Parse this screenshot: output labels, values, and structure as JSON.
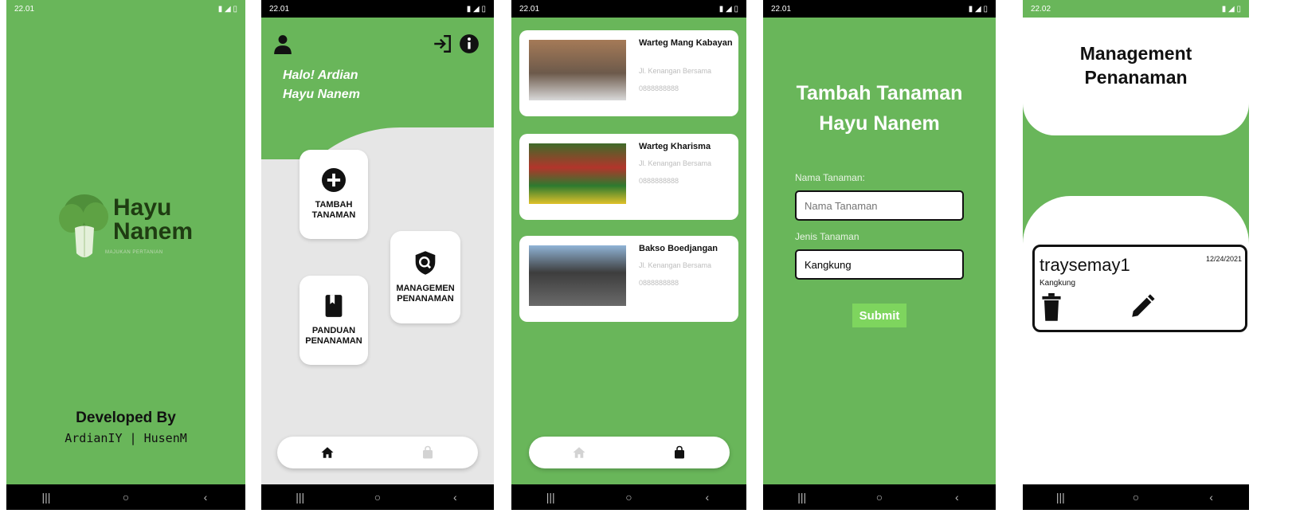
{
  "colors": {
    "brand_green": "#69b65a",
    "light_gray": "#e6e6e6",
    "submit_green": "#7ed55e",
    "black": "#111111"
  },
  "screen1": {
    "status_time": "22.01",
    "logo_title_line1": "Hayu",
    "logo_title_line2": "Nanem",
    "logo_tagline": "MAJUKAN PERTANIAN",
    "dev_title": "Developed By",
    "dev_names": "ArdianIY | HusenM"
  },
  "screen2": {
    "status_time": "22.01",
    "greeting_line1": "Halo! Ardian",
    "greeting_line2": "Hayu Nanem",
    "menu": {
      "tambah": "TAMBAH\nTANAMAN",
      "managemen": "MANAGEMEN\nPENANAMAN",
      "panduan": "PANDUAN\nPENANAMAN"
    },
    "icons": {
      "user": "user-icon",
      "logout": "logout-icon",
      "info": "info-icon",
      "home": "home-icon",
      "bag": "shopping-bag-icon"
    }
  },
  "screen3": {
    "status_time": "22.01",
    "warungs": [
      {
        "name": "Warteg Mang Kabayan",
        "address": "Jl. Kenangan Bersama",
        "phone": "0888888888"
      },
      {
        "name": "Warteg Kharisma",
        "address": "Jl. Kenangan Bersama",
        "phone": "0888888888"
      },
      {
        "name": "Bakso Boedjangan",
        "address": "Jl. Kenangan Bersama",
        "phone": "0888888888"
      }
    ]
  },
  "screen4": {
    "status_time": "22.01",
    "title_line1": "Tambah Tanaman",
    "title_line2": "Hayu Nanem",
    "nama_label": "Nama Tanaman:",
    "nama_placeholder": "Nama Tanaman",
    "jenis_label": "Jenis Tanaman",
    "jenis_value": "Kangkung",
    "submit_label": "Submit"
  },
  "screen5": {
    "status_time": "22.02",
    "title_line1": "Management",
    "title_line2": "Penanaman",
    "plant": {
      "name": "traysemay1",
      "type": "Kangkung",
      "date": "12/24/2021"
    }
  }
}
